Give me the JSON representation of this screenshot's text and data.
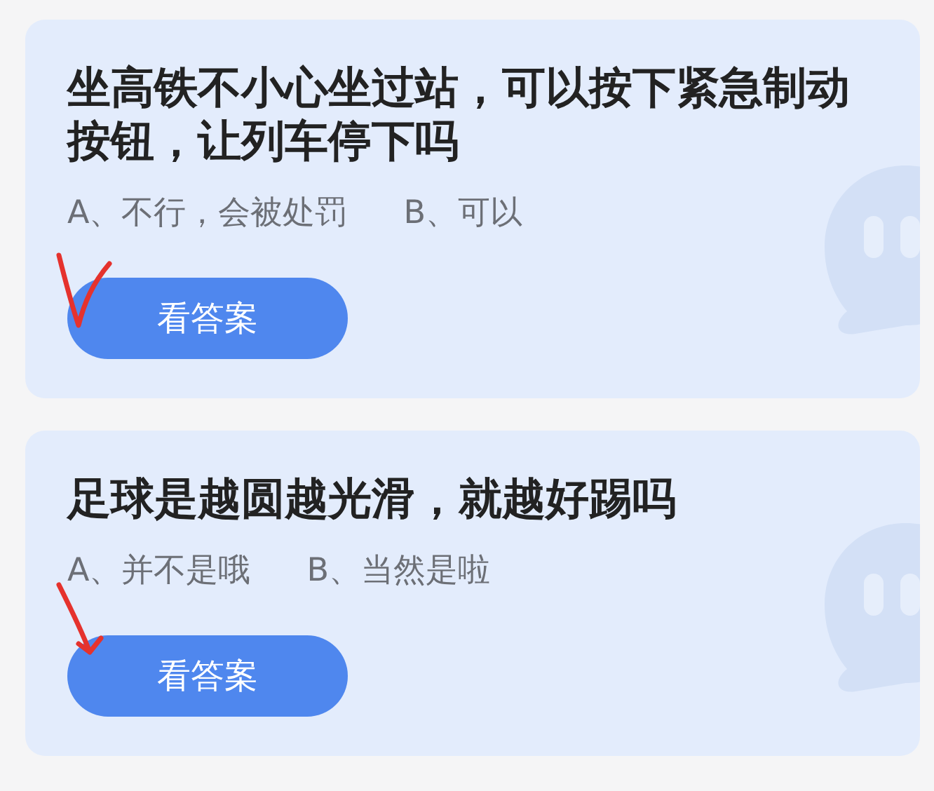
{
  "cards": [
    {
      "question": "坐高铁不小心坐过站，可以按下紧急制动按钮，让列车停下吗",
      "options": [
        "A、不行，会被处罚",
        "B、可以"
      ],
      "button": "看答案",
      "annotation": {
        "kind": "tick"
      }
    },
    {
      "question": "足球是越圆越光滑，就越好踢吗",
      "options": [
        "A、并不是哦",
        "B、当然是啦"
      ],
      "button": "看答案",
      "annotation": {
        "kind": "arrow"
      }
    }
  ]
}
